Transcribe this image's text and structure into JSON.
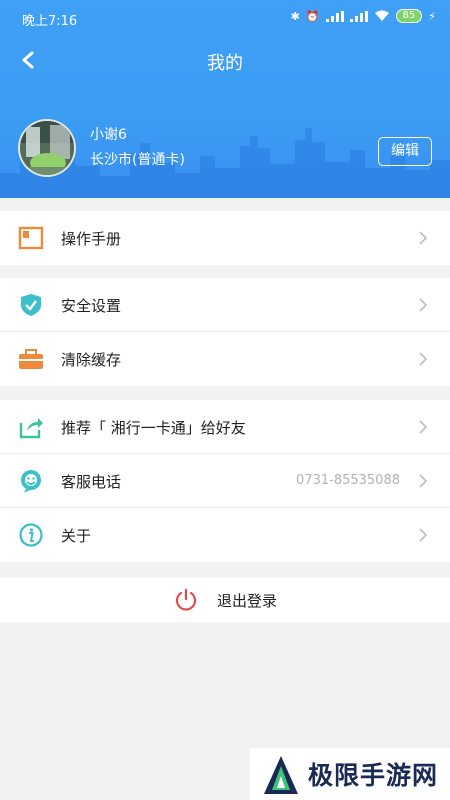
{
  "status_bar": {
    "time": "晚上7:16",
    "battery": "85"
  },
  "header": {
    "title": "我的"
  },
  "profile": {
    "name": "小谢6",
    "city": "长沙市(普通卡)",
    "edit_label": "编辑"
  },
  "menu_groups": [
    {
      "items": [
        {
          "label": "操作手册",
          "icon": "manual-icon"
        }
      ]
    },
    {
      "items": [
        {
          "label": "安全设置",
          "icon": "shield-icon"
        },
        {
          "label": "清除缓存",
          "icon": "briefcase-icon"
        }
      ]
    },
    {
      "items": [
        {
          "label": "推荐「 湘行一卡通」给好友",
          "icon": "share-icon"
        },
        {
          "label": "客服电话",
          "value": "0731-85535088",
          "icon": "customer-service-icon"
        },
        {
          "label": "关于",
          "icon": "info-icon"
        }
      ]
    }
  ],
  "logout": {
    "label": "退出登录"
  },
  "watermark": {
    "text": "极限手游网"
  },
  "colors": {
    "header_blue": "#3b9cf3",
    "manual_orange": "#f08a3b",
    "teal": "#3bbfc8",
    "logout_red": "#e14b4b"
  }
}
